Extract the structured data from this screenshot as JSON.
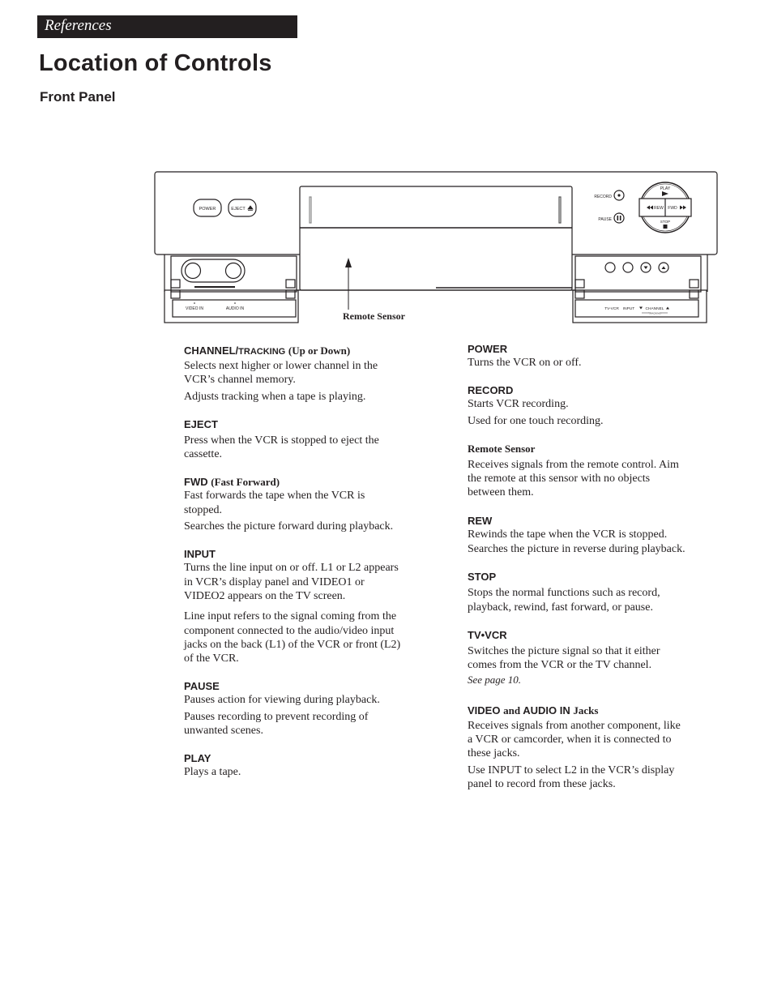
{
  "header": {
    "section": "References",
    "title": "Location of Controls",
    "subtitle": "Front Panel"
  },
  "diagram": {
    "buttons": {
      "power": "POWER",
      "eject": "EJECT",
      "record": "RECORD",
      "pause": "PAUSE",
      "play": "PLAY",
      "rew": "REW",
      "fwd": "FWD",
      "stop": "STOP"
    },
    "jacks": {
      "video_in": "VIDEO IN",
      "audio_in": "AUDIO IN"
    },
    "right_panel": {
      "tv_vcr": "TV-VCR",
      "input": "INPUT",
      "channel": "CHANNEL",
      "tracking": "TRACKING"
    },
    "callout": "Remote Sensor"
  },
  "left_column": [
    {
      "heading": "CHANNEL/",
      "heading_small": "TRACKING",
      "heading_suffix": "(Up or Down)",
      "paragraphs": [
        "Selects next higher or lower channel in the VCR’s channel memory.",
        "Adjusts tracking when a tape is playing."
      ]
    },
    {
      "heading": "EJECT",
      "paragraphs": [
        "Press when the VCR is stopped to eject the cassette."
      ]
    },
    {
      "heading": "FWD",
      "heading_suffix": "(Fast Forward)",
      "paragraphs": [
        "Fast forwards the tape when the VCR is stopped.",
        "Searches the picture forward during playback."
      ]
    },
    {
      "heading": "INPUT",
      "paragraphs": [
        "Turns the line input on or off.  L1 or L2 appears in VCR’s display panel and VIDEO1 or VIDEO2 appears on the TV screen.",
        "Line input refers to the signal coming from the component connected to the audio/video input jacks on the back (L1) of the VCR or front (L2) of the VCR."
      ]
    },
    {
      "heading": "PAUSE",
      "paragraphs": [
        "Pauses action for viewing during playback.",
        "Pauses recording to prevent recording of unwanted scenes."
      ]
    },
    {
      "heading": "PLAY",
      "paragraphs": [
        "Plays a tape."
      ]
    }
  ],
  "right_column": [
    {
      "heading": "POWER",
      "paragraphs": [
        "Turns the VCR on or off."
      ]
    },
    {
      "heading": "RECORD",
      "paragraphs": [
        "Starts VCR recording.",
        "Used for one touch recording."
      ]
    },
    {
      "heading": "Remote Sensor",
      "paragraphs": [
        "Receives signals from the remote control. Aim the remote at this sensor with no objects between them."
      ]
    },
    {
      "heading": "REW",
      "paragraphs": [
        "Rewinds the tape when the VCR is stopped.",
        "Searches the picture in reverse during playback."
      ]
    },
    {
      "heading": "STOP",
      "paragraphs": [
        "Stops the normal functions such as record, playback, rewind, fast forward, or pause."
      ]
    },
    {
      "heading": "TV•VCR",
      "paragraphs": [
        "Switches the picture signal so that it either comes from the VCR or the TV channel."
      ],
      "note": "See page 10."
    },
    {
      "heading": "VIDEO",
      "heading_mid": "and",
      "heading_2": "AUDIO IN",
      "heading_suffix": "Jacks",
      "paragraphs": [
        "Receives signals from another component, like a VCR or camcorder, when it is connected to these jacks.",
        "Use INPUT to select L2 in the VCR’s display panel to record from these jacks."
      ]
    }
  ]
}
